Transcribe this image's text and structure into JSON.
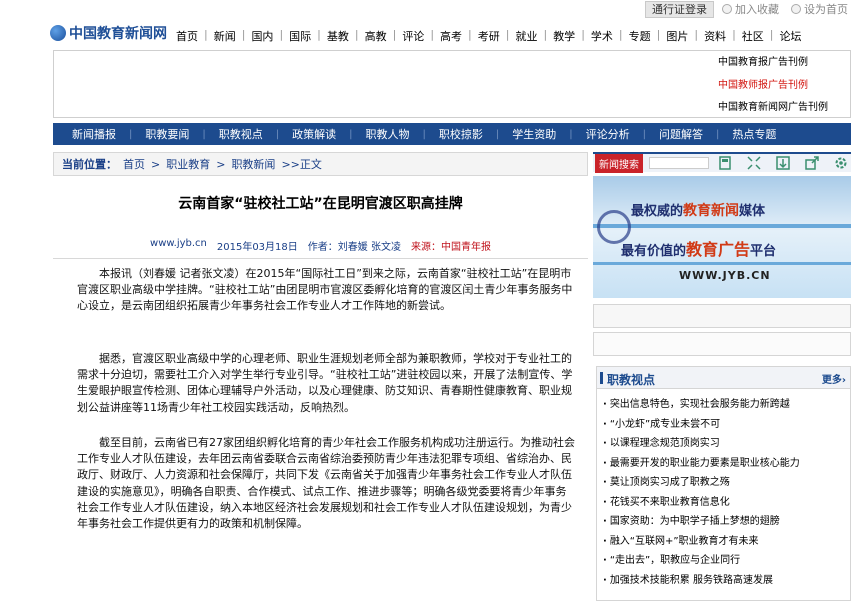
{
  "util": {
    "login": "通行证登录",
    "favorite": "加入收藏",
    "homepage": "设为首页"
  },
  "logo": {
    "text": "中国教育新闻网"
  },
  "mainnav": [
    "首页",
    "新闻",
    "国内",
    "国际",
    "基教",
    "高教",
    "评论",
    "高考",
    "考研",
    "就业",
    "教学",
    "学术",
    "专题",
    "图片",
    "资料",
    "社区",
    "论坛"
  ],
  "adlinks": [
    "中国教育报广告刊例",
    "中国教师报广告刊例",
    "中国教育新闻网广告刊例"
  ],
  "subnav": [
    "新闻播报",
    "职教要闻",
    "职教视点",
    "政策解读",
    "职教人物",
    "职校掠影",
    "学生资助",
    "评论分析",
    "问题解答",
    "热点专题"
  ],
  "breadcrumb": {
    "label": "当前位置：",
    "items": [
      "首页",
      ">",
      "职业教育",
      ">",
      "职教新闻",
      ">>正文"
    ]
  },
  "article": {
    "title": "云南首家“驻校社工站”在昆明官渡区职高挂牌",
    "site": "www.jyb.cn",
    "date": "2015年03月18日",
    "author": "作者：刘春媛 张文凌",
    "source": "来源：中国青年报",
    "paragraphs": [
      "本报讯（刘春媛 记者张文凌）在2015年“国际社工日”到来之际，云南首家“驻校社工站”在昆明市官渡区职业高级中学挂牌。“驻校社工站”由团昆明市官渡区委孵化培育的官渡区闰土青少年事务服务中心设立，是云南团组织拓展青少年事务社会工作专业人才工作阵地的新尝试。",
      "据悉，官渡区职业高级中学的心理老师、职业生涯规划老师全部为兼职教师，学校对于专业社工的需求十分迫切，需要社工介入对学生举行专业引导。“驻校社工站”进驻校园以来，开展了法制宣传、学生爱眼护眼宣传检测、团体心理辅导户外活动，以及心理健康、防艾知识、青春期性健康教育、职业规划公益讲座等11场青少年社工校园实践活动，反响热烈。",
      "截至目前，云南省已有27家团组织孵化培育的青少年社会工作服务机构成功注册运行。为推动社会工作专业人才队伍建设，去年团云南省委联合云南省综治委预防青少年违法犯罪专项组、省综治办、民政厅、财政厅、人力资源和社会保障厅，共同下发《云南省关于加强青少年事务社会工作专业人才队伍建设的实施意见》，明确各自职责、合作模式、试点工作、推进步骤等；明确各级党委要将青少年事务社会工作专业人才队伍建设，纳入本地区经济社会发展规划和社会工作专业人才队伍建设规划，为青少年事务社会工作提供更有力的政策和机制保障。"
    ]
  },
  "sidebar": {
    "search_tag": "新闻搜索",
    "tools": [
      "save-icon",
      "expand-icon",
      "download-icon",
      "share-icon",
      "settings-icon"
    ],
    "banner": {
      "line1a": "最权威的",
      "line1b": "教育新闻",
      "line1c": "媒体",
      "line2a": "最有价值的",
      "line2b": "教育广告",
      "line2c": "平台",
      "url": "WWW.JYB.CN"
    },
    "viewpoint": {
      "title": "职教视点",
      "more": "更多›",
      "items": [
        "突出信息特色，实现社会服务能力新跨越",
        "“小龙虾”成专业未尝不可",
        "以课程理念规范顶岗实习",
        "最需要开发的职业能力要素是职业核心能力",
        "莫让顶岗实习成了职教之殇",
        "花钱买不来职业教育信息化",
        "国家资助：为中职学子插上梦想的翅膀",
        "融入“互联网+”职业教育才有未来",
        "“走出去”，职教应与企业同行",
        "加强技术技能积累 服务铁路高速发展"
      ]
    }
  }
}
